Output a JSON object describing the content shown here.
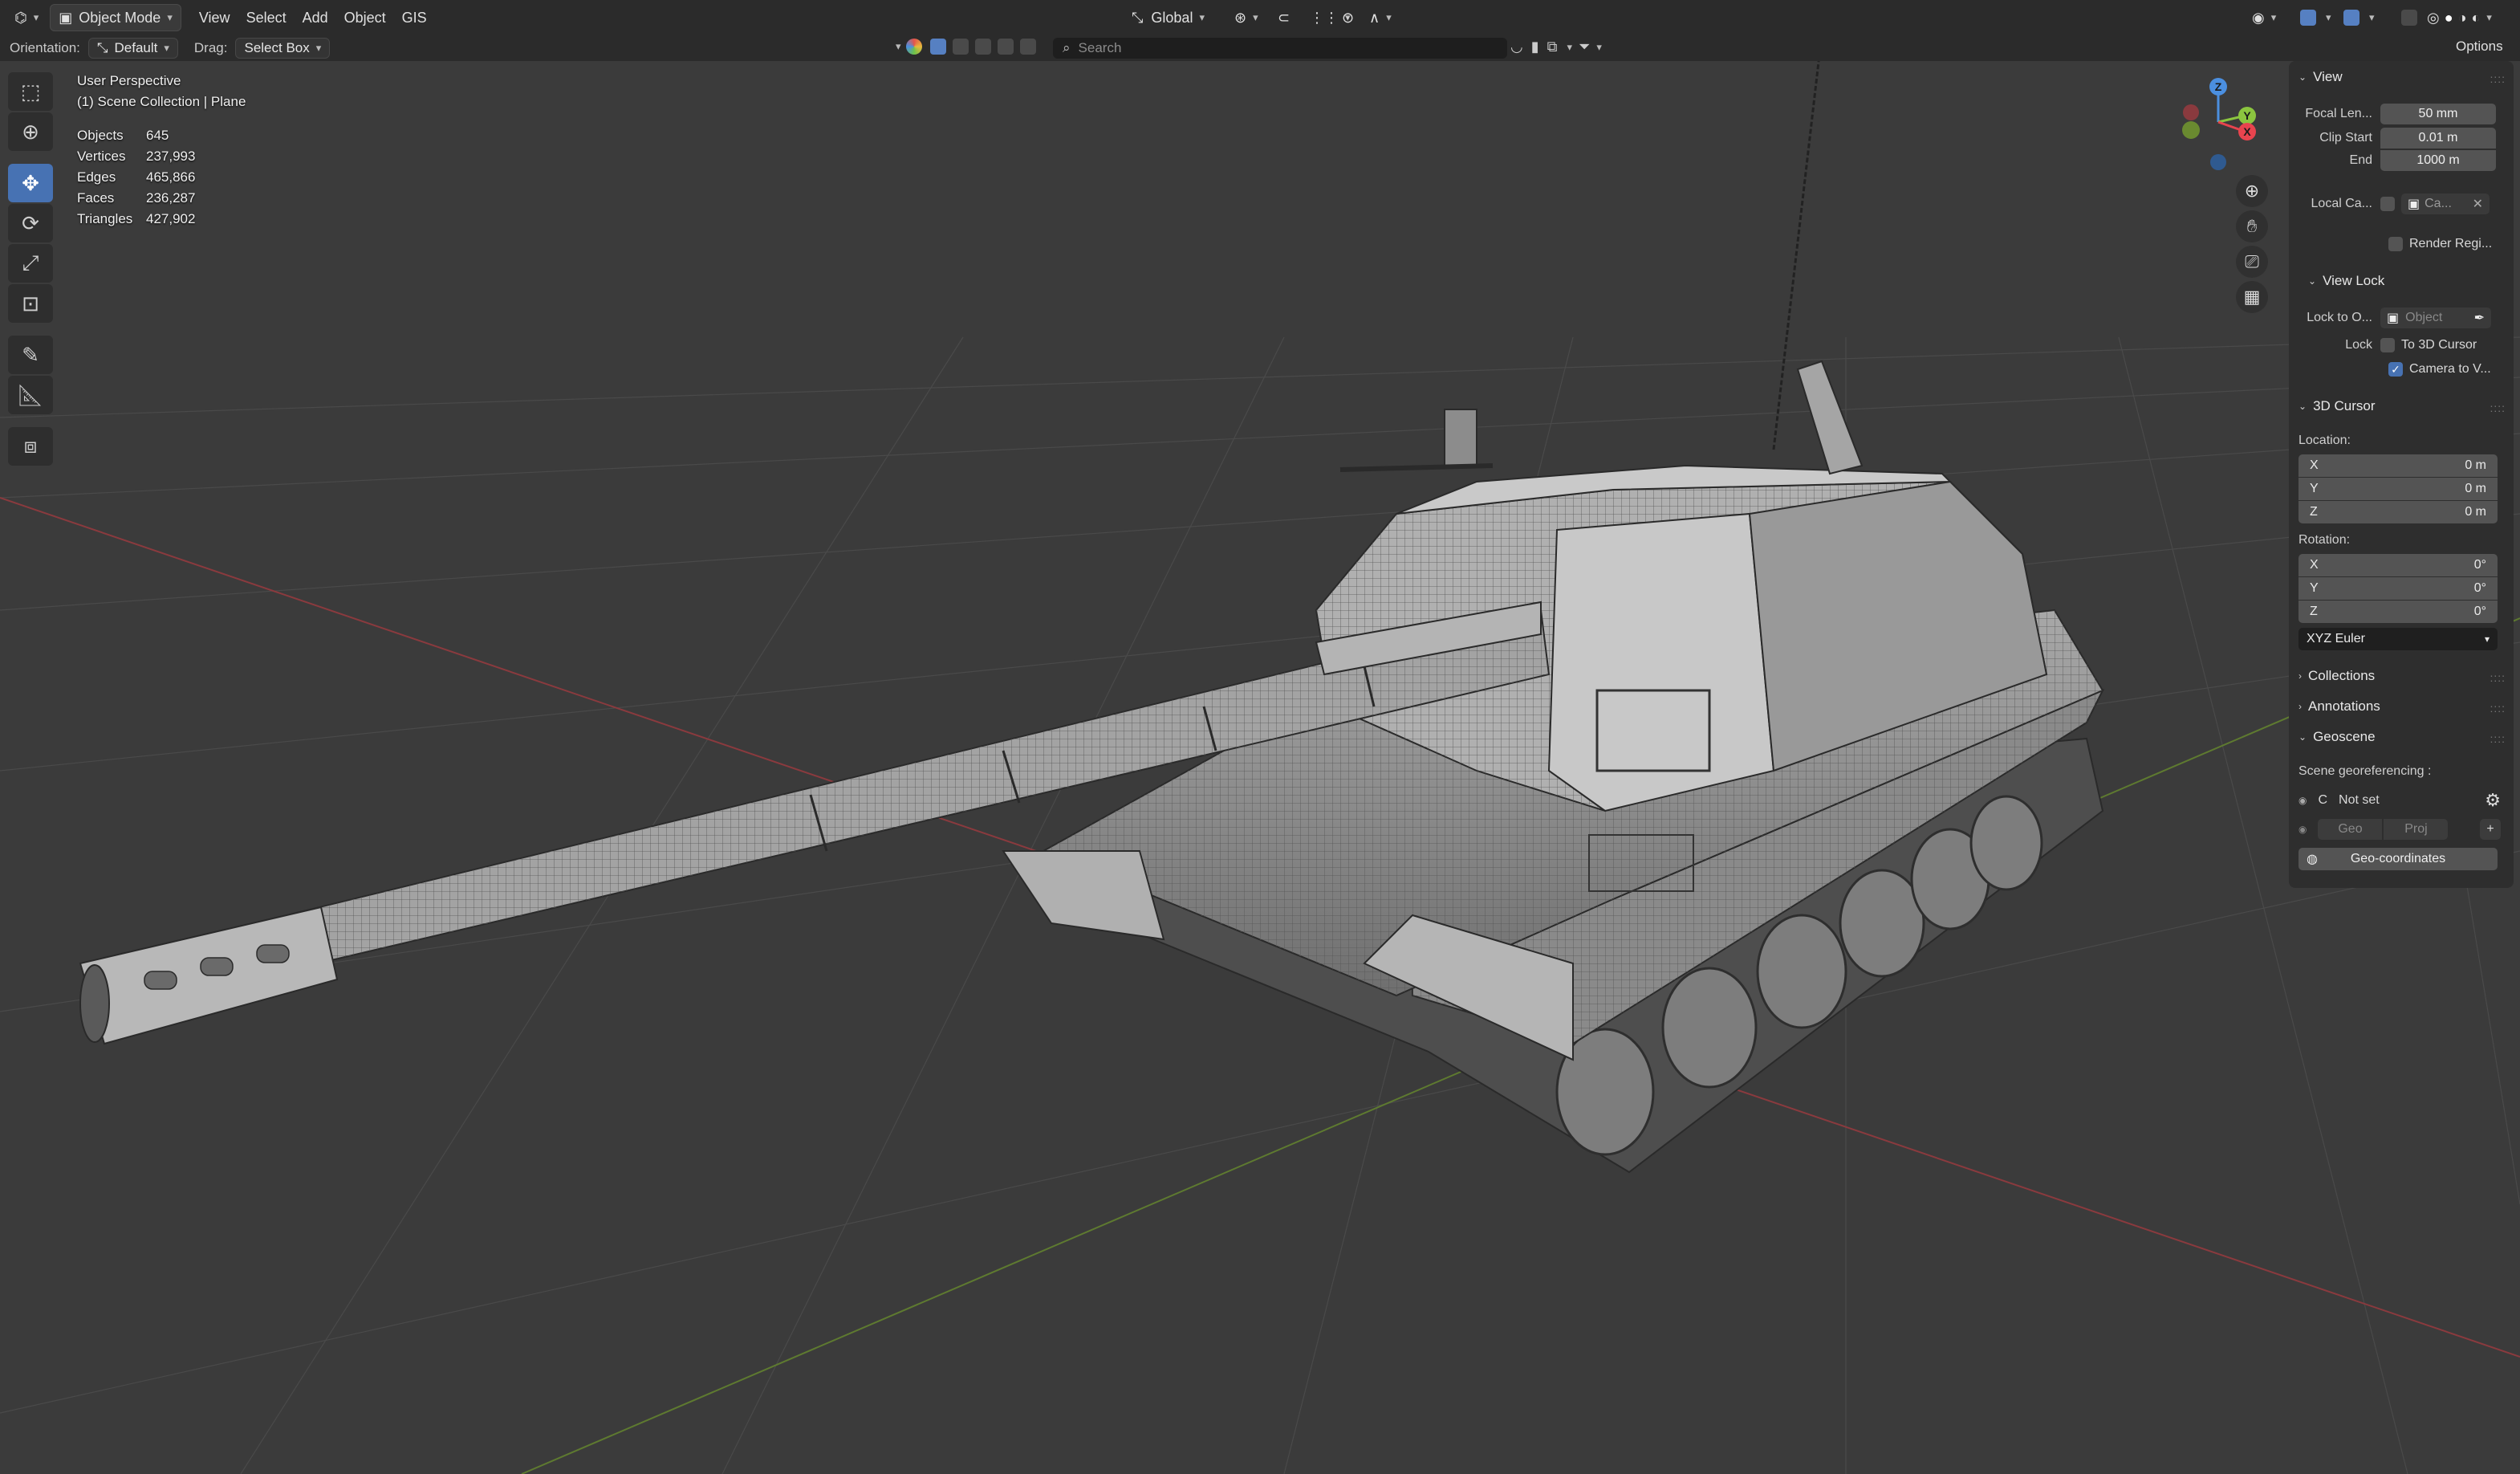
{
  "header": {
    "editor_icon": "3d-viewport-icon",
    "mode": "Object Mode",
    "menus": [
      "View",
      "Select",
      "Add",
      "Object",
      "GIS"
    ],
    "transform_space": "Global",
    "options_label": "Options"
  },
  "subheader": {
    "orientation_label": "Orientation:",
    "orientation_value": "Default",
    "drag_label": "Drag:",
    "drag_value": "Select Box",
    "search_placeholder": "Search"
  },
  "overlay": {
    "perspective": "User Perspective",
    "collection": "(1) Scene Collection | Plane",
    "stats": [
      {
        "label": "Objects",
        "value": "645"
      },
      {
        "label": "Vertices",
        "value": "237,993"
      },
      {
        "label": "Edges",
        "value": "465,866"
      },
      {
        "label": "Faces",
        "value": "236,287"
      },
      {
        "label": "Triangles",
        "value": "427,902"
      }
    ]
  },
  "tools": [
    "select-box-icon",
    "cursor-icon",
    "move-icon",
    "rotate-icon",
    "scale-icon",
    "transform-icon",
    "annotate-icon",
    "measure-icon",
    "add-cube-icon"
  ],
  "gizmo": {
    "z": "Z",
    "y": "Y",
    "x": "X"
  },
  "colors": {
    "accent": "#4772b3",
    "x_axis": "#e8444e",
    "y_axis": "#8bc53f",
    "z_axis": "#4b8fe0",
    "panel": "#2e2e2e",
    "field": "#545454"
  },
  "npanel": {
    "view": {
      "title": "View",
      "focal_label": "Focal Len...",
      "focal_value": "50 mm",
      "clip_start_label": "Clip Start",
      "clip_start_value": "0.01 m",
      "end_label": "End",
      "end_value": "1000 m",
      "local_camera_label": "Local Ca...",
      "local_camera_value": "Ca...",
      "render_region_label": "Render Regi..."
    },
    "view_lock": {
      "title": "View Lock",
      "lock_to_label": "Lock to O...",
      "lock_to_placeholder": "Object",
      "lock_label": "Lock",
      "to_cursor_label": "To 3D Cursor",
      "camera_to_view_label": "Camera to V..."
    },
    "cursor": {
      "title": "3D Cursor",
      "location_label": "Location:",
      "location": [
        {
          "axis": "X",
          "value": "0 m"
        },
        {
          "axis": "Y",
          "value": "0 m"
        },
        {
          "axis": "Z",
          "value": "0 m"
        }
      ],
      "rotation_label": "Rotation:",
      "rotation": [
        {
          "axis": "X",
          "value": "0°"
        },
        {
          "axis": "Y",
          "value": "0°"
        },
        {
          "axis": "Z",
          "value": "0°"
        }
      ],
      "rotation_mode": "XYZ Euler"
    },
    "collections": "Collections",
    "annotations": "Annotations",
    "geoscene": {
      "title": "Geoscene",
      "georef_label": "Scene georeferencing :",
      "crs_letter": "C",
      "not_set": "Not set",
      "geo_label": "Geo",
      "proj_label": "Proj",
      "geo_coords_button": "Geo-coordinates"
    }
  }
}
